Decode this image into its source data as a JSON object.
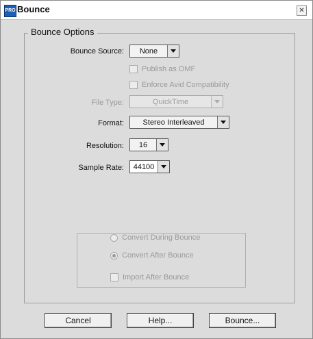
{
  "window": {
    "title": "Bounce",
    "app_icon_text": "PRO",
    "close_glyph": "✕"
  },
  "group": {
    "label": "Bounce Options"
  },
  "fields": {
    "bounce_source": {
      "label": "Bounce Source:",
      "value": "None"
    },
    "file_type": {
      "label": "File Type:",
      "value": "QuickTime"
    },
    "format": {
      "label": "Format:",
      "value": "Stereo Interleaved"
    },
    "resolution": {
      "label": "Resolution:",
      "value": "16"
    },
    "sample_rate": {
      "label": "Sample Rate:",
      "value": "44100"
    }
  },
  "checkboxes": {
    "publish_omf": {
      "label": "Publish as OMF",
      "checked": false,
      "enabled": false
    },
    "enforce_avid": {
      "label": "Enforce Avid Compatibility",
      "checked": false,
      "enabled": false
    },
    "import_after": {
      "label": "Import After Bounce",
      "checked": false,
      "enabled": false
    }
  },
  "radios": {
    "convert_during": {
      "label": "Convert During Bounce",
      "selected": false,
      "enabled": false
    },
    "convert_after": {
      "label": "Convert After Bounce",
      "selected": true,
      "enabled": false
    }
  },
  "buttons": {
    "cancel": "Cancel",
    "help": "Help...",
    "bounce": "Bounce..."
  },
  "colors": {
    "dialog_bg": "#dcdcdc",
    "disabled_text": "#9a9a9a",
    "icon_blue": "#1e5fb8"
  }
}
